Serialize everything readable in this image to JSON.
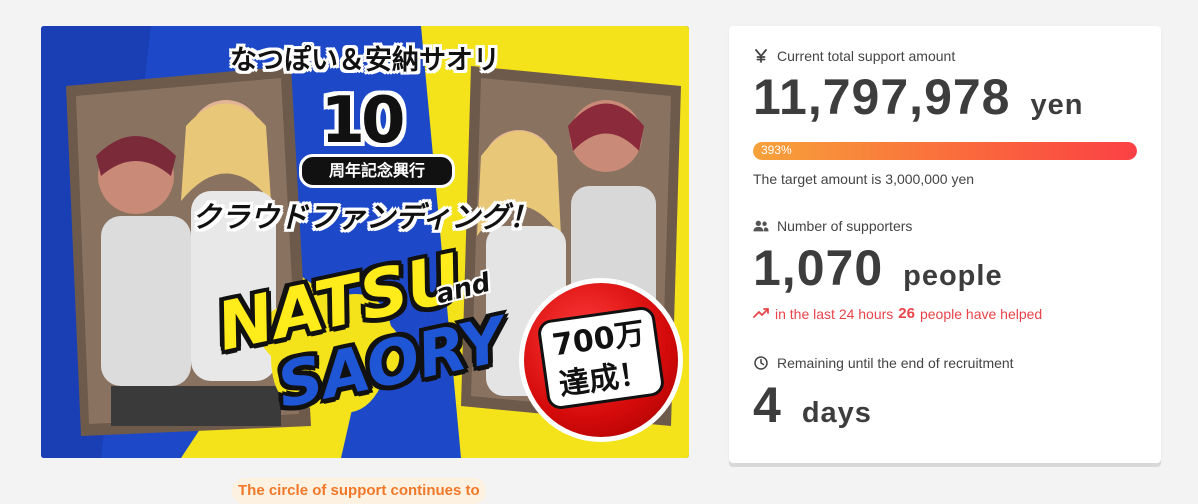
{
  "hero": {
    "title_jp": "なつぽい＆安納サオリ",
    "number": "10",
    "anniversary": "周年記念興行",
    "crowdfunding": "クラウドファンディング！",
    "name1": "NATSU",
    "and": "and",
    "name2": "SAORY",
    "badge_line1": "700万",
    "badge_line2": "達成！"
  },
  "stats": {
    "amount_label": "Current total support amount",
    "amount_value": "11,797,978",
    "amount_unit": "yen",
    "progress_text": "393%",
    "progress_percent": 393,
    "target_text": "The target amount is 3,000,000 yen",
    "supporters_label": "Number of supporters",
    "supporters_value": "1,070",
    "supporters_unit": "people",
    "trend_prefix": "in the last 24 hours",
    "trend_count": "26",
    "trend_suffix": "people have helped",
    "remaining_label": "Remaining until the end of recruitment",
    "remaining_value": "4",
    "remaining_unit": "days"
  },
  "tagline": "The circle of support continues to",
  "icons": {
    "yen": "yen-icon",
    "people": "people-icon",
    "trend": "trending-up-icon",
    "clock": "clock-icon"
  },
  "colors": {
    "progress_start": "#f7a23a",
    "progress_end": "#fb4045",
    "trend": "#e8444a",
    "tagline": "#f07828"
  }
}
